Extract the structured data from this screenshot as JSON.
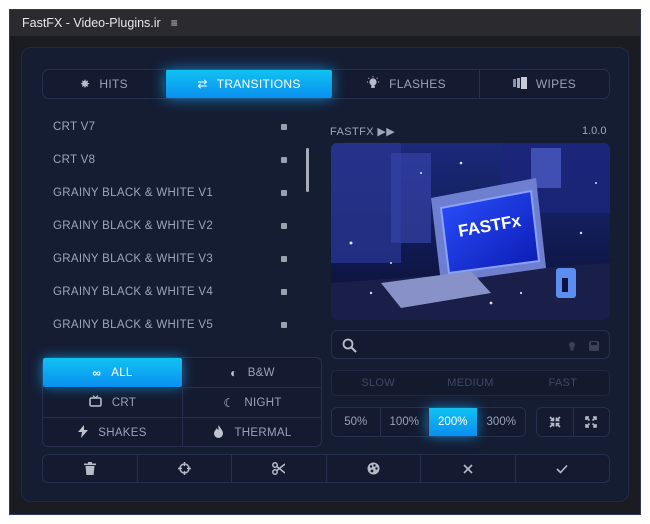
{
  "window": {
    "title": "FastFX - Video-Plugins.ir",
    "menu_icon": "hamburger-menu-icon"
  },
  "tabs": [
    {
      "label": "HITS",
      "icon": "burst-icon",
      "active": false
    },
    {
      "label": "TRANSITIONS",
      "icon": "swap-arrows-icon",
      "active": true
    },
    {
      "label": "FLASHES",
      "icon": "lightbulb-icon",
      "active": false
    },
    {
      "label": "WIPES",
      "icon": "wipe-icon",
      "active": false
    }
  ],
  "list": {
    "items": [
      "CRT V7",
      "CRT V8",
      "GRAINY BLACK & WHITE V1",
      "GRAINY BLACK & WHITE V2",
      "GRAINY BLACK & WHITE V3",
      "GRAINY BLACK & WHITE V4",
      "GRAINY BLACK & WHITE V5"
    ]
  },
  "preview": {
    "brand": "FASTFX ▶▶",
    "version": "1.0.0",
    "image_text": "FASTFx"
  },
  "search": {
    "placeholder": "",
    "value": ""
  },
  "categories": [
    {
      "label": "ALL",
      "icon": "infinity-icon",
      "active": true
    },
    {
      "label": "B&W",
      "icon": "half-circle-icon",
      "active": false
    },
    {
      "label": "CRT",
      "icon": "tv-icon",
      "active": false
    },
    {
      "label": "NIGHT",
      "icon": "moon-icon",
      "active": false
    },
    {
      "label": "SHAKES",
      "icon": "lightning-icon",
      "active": false
    },
    {
      "label": "THERMAL",
      "icon": "flame-icon",
      "active": false
    }
  ],
  "speed": [
    "SLOW",
    "MEDIUM",
    "FAST"
  ],
  "zoom": {
    "options": [
      "50%",
      "100%",
      "200%",
      "300%"
    ],
    "selected": "200%"
  },
  "bottom_actions": [
    "trash-icon",
    "crosshair-icon",
    "scissors-icon",
    "palette-icon",
    "close-icon",
    "check-icon"
  ],
  "colors": {
    "accent": "#0fb6f5",
    "panel": "#151d33",
    "text": "#9ea5b9"
  }
}
